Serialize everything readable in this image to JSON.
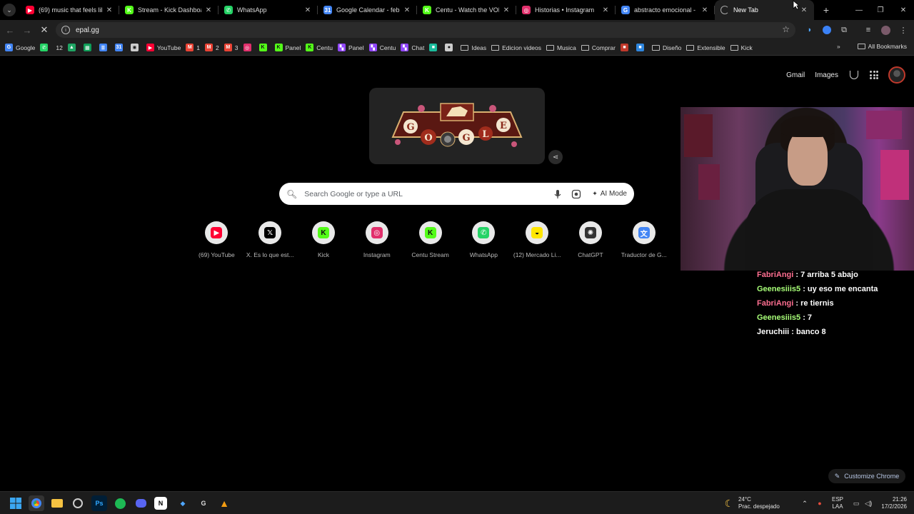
{
  "tabs": [
    {
      "title": "(69) music that feels like",
      "favicon": "youtube-icon",
      "color": "#ff0033"
    },
    {
      "title": "Stream - Kick Dashboard",
      "favicon": "kick-icon",
      "color": "#53fc18"
    },
    {
      "title": "WhatsApp",
      "favicon": "whatsapp-icon",
      "color": "#25d366"
    },
    {
      "title": "Google Calendar - febrero",
      "favicon": "calendar-icon",
      "color": "#4285f4"
    },
    {
      "title": "Centu - Watch the VOD o",
      "favicon": "kick-icon",
      "color": "#53fc18"
    },
    {
      "title": "Historias • Instagram",
      "favicon": "instagram-icon",
      "color": "#e1306c"
    },
    {
      "title": "abstracto emocional - Bu",
      "favicon": "google-icon",
      "color": "#4285f4"
    },
    {
      "title": "New Tab",
      "favicon": "loading-icon",
      "color": "#888888"
    }
  ],
  "address_bar": {
    "url": "epal.gg"
  },
  "bookmarks": [
    {
      "label": "Google",
      "icon": "google-icon",
      "color": "#4285f4"
    },
    {
      "label": "",
      "icon": "whatsapp-icon",
      "color": "#25d366"
    },
    {
      "label": "12",
      "icon": "",
      "color": ""
    },
    {
      "label": "",
      "icon": "drive-icon",
      "color": "#1fa463"
    },
    {
      "label": "",
      "icon": "sheets-icon",
      "color": "#0f9d58"
    },
    {
      "label": "",
      "icon": "docs-icon",
      "color": "#4285f4"
    },
    {
      "label": "",
      "icon": "calendar-icon",
      "color": "#4285f4"
    },
    {
      "label": "",
      "icon": "chatgpt-icon",
      "color": "#cccccc"
    },
    {
      "label": "YouTube",
      "icon": "youtube-icon",
      "color": "#ff0033"
    },
    {
      "label": "1",
      "icon": "gmail-icon",
      "color": "#ea4335"
    },
    {
      "label": "2",
      "icon": "gmail-icon",
      "color": "#ea4335"
    },
    {
      "label": "3",
      "icon": "gmail-icon",
      "color": "#ea4335"
    },
    {
      "label": "",
      "icon": "instagram-icon",
      "color": "#e1306c"
    },
    {
      "label": "",
      "icon": "kick-icon",
      "color": "#53fc18"
    },
    {
      "label": "Panel",
      "icon": "kick-icon",
      "color": "#53fc18"
    },
    {
      "label": "Centu",
      "icon": "kick-icon",
      "color": "#53fc18"
    },
    {
      "label": "Panel",
      "icon": "twitch-icon",
      "color": "#9146ff"
    },
    {
      "label": "Centu",
      "icon": "twitch-icon",
      "color": "#9146ff"
    },
    {
      "label": "Chat",
      "icon": "twitch-icon",
      "color": "#9146ff"
    },
    {
      "label": "",
      "icon": "app-icon",
      "color": "#1abc9c"
    },
    {
      "label": "",
      "icon": "github-icon",
      "color": "#cccccc"
    },
    {
      "label": "Ideas",
      "icon": "folder-icon",
      "color": ""
    },
    {
      "label": "Edicion videos",
      "icon": "folder-icon",
      "color": ""
    },
    {
      "label": "Musica",
      "icon": "folder-icon",
      "color": ""
    },
    {
      "label": "Comprar",
      "icon": "folder-icon",
      "color": ""
    },
    {
      "label": "",
      "icon": "app-icon",
      "color": "#c0392b"
    },
    {
      "label": "",
      "icon": "app-icon",
      "color": "#2e86de"
    },
    {
      "label": "Diseño",
      "icon": "folder-icon",
      "color": ""
    },
    {
      "label": "Extensible",
      "icon": "folder-icon",
      "color": ""
    },
    {
      "label": "Kick",
      "icon": "folder-icon",
      "color": ""
    }
  ],
  "all_bookmarks": "All Bookmarks",
  "top_links": {
    "gmail": "Gmail",
    "images": "Images"
  },
  "search": {
    "placeholder": "Search Google or type a URL",
    "ai_mode": "AI Mode"
  },
  "shortcuts": [
    {
      "label": "(69) YouTube",
      "icon": "youtube-icon",
      "color": "#ff0033"
    },
    {
      "label": "X. Es lo que est...",
      "icon": "x-icon",
      "color": "#000000"
    },
    {
      "label": "Kick",
      "icon": "kick-icon",
      "color": "#53fc18"
    },
    {
      "label": "Instagram",
      "icon": "instagram-icon",
      "color": "#e1306c"
    },
    {
      "label": "Centu Stream",
      "icon": "kick-icon",
      "color": "#53fc18"
    },
    {
      "label": "WhatsApp",
      "icon": "whatsapp-icon",
      "color": "#25d366"
    },
    {
      "label": "(12) Mercado Li...",
      "icon": "mercadolibre-icon",
      "color": "#ffe600"
    },
    {
      "label": "ChatGPT",
      "icon": "chatgpt-icon",
      "color": "#333333"
    },
    {
      "label": "Traductor de G...",
      "icon": "translate-icon",
      "color": "#4285f4"
    }
  ],
  "customize_chrome": "Customize Chrome",
  "chat": [
    {
      "user": "FabriAngi",
      "message": " : 7 arriba 5 abajo",
      "color": "#ff6f91"
    },
    {
      "user": "Geenesiiis5",
      "message": " : uy eso me encanta",
      "color": "#a8ff78"
    },
    {
      "user": "FabriAngi",
      "message": " : re tiernis",
      "color": "#ff6f91"
    },
    {
      "user": "Geenesiiis5",
      "message": " : 7",
      "color": "#a8ff78"
    },
    {
      "user": "Jeruchiii",
      "message": " : banco 8",
      "color": "#ffffff"
    }
  ],
  "taskbar": {
    "weather_temp": "24°C",
    "weather_desc": "Prac. despejado",
    "lang_1": "ESP",
    "lang_2": "LAA",
    "time": "21:26",
    "date": "17/2/2026"
  }
}
